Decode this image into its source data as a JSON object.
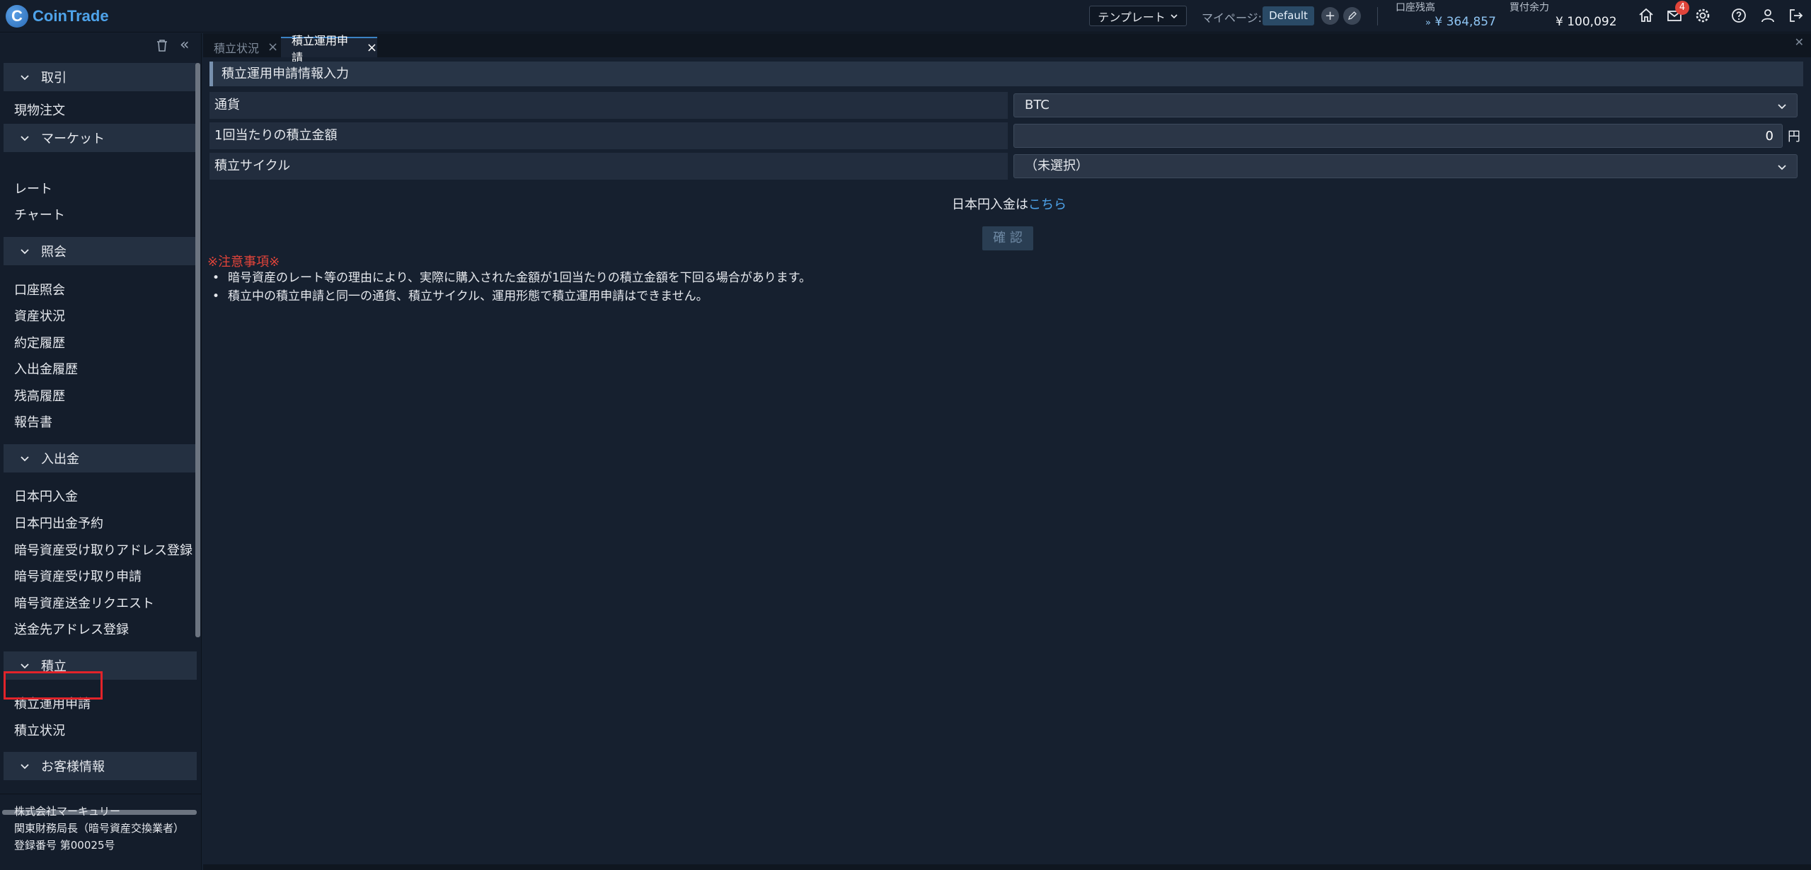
{
  "app": {
    "brand": "CoinTrade",
    "logo_letter": "C"
  },
  "header": {
    "template_label": "テンプレート",
    "mypage_label": "マイページ:",
    "default_label": "Default",
    "plus_label": "+",
    "balance_label": "口座残高",
    "balance_value": "¥ 364,857",
    "buying_power_label": "買付余力",
    "buying_power_value": "¥ 100,092",
    "mail_badge": "4"
  },
  "sidebar": {
    "groups": [
      {
        "title": "取引",
        "items": [
          "現物注文"
        ]
      },
      {
        "title": "マーケット",
        "items": [
          "レート",
          "チャート"
        ]
      },
      {
        "title": "照会",
        "items": [
          "口座照会",
          "資産状況",
          "約定履歴",
          "入出金履歴",
          "残高履歴",
          "報告書"
        ]
      },
      {
        "title": "入出金",
        "items": [
          "日本円入金",
          "日本円出金予約",
          "暗号資産受け取りアドレス登録",
          "暗号資産受け取り申請",
          "暗号資産送金リクエスト",
          "送金先アドレス登録"
        ]
      },
      {
        "title": "積立",
        "items": [
          "積立運用申請",
          "積立状況"
        ]
      },
      {
        "title": "お客様情報",
        "items": []
      }
    ],
    "company": {
      "name": "株式会社マーキュリー",
      "registrar": "関東財務局長（暗号資産交換業者）",
      "reg_number": "登録番号 第00025号"
    }
  },
  "tabs": [
    {
      "label": "積立状況",
      "active": false
    },
    {
      "label": "積立運用申請",
      "active": true
    }
  ],
  "form": {
    "section_title": "積立運用申請情報入力",
    "currency_label": "通貨",
    "currency_value": "BTC",
    "amount_label": "1回当たりの積立金額",
    "amount_value": "0",
    "amount_unit": "円",
    "cycle_label": "積立サイクル",
    "cycle_value": "（未選択）",
    "deposit_text": "日本円入金は",
    "deposit_link": "こちら",
    "confirm_label": "確 認"
  },
  "notice": {
    "title": "※注意事項※",
    "items": [
      "暗号資産のレート等の理由により、実際に購入された金額が1回当たりの積立金額を下回る場合があります。",
      "積立中の積立申請と同一の通貨、積立サイクル、運用形態で積立運用申請はできません。"
    ]
  },
  "colors": {
    "accent": "#4ea3ea",
    "highlight": "#e2232a",
    "badge": "#e0443a",
    "notice": "#e2443a"
  }
}
